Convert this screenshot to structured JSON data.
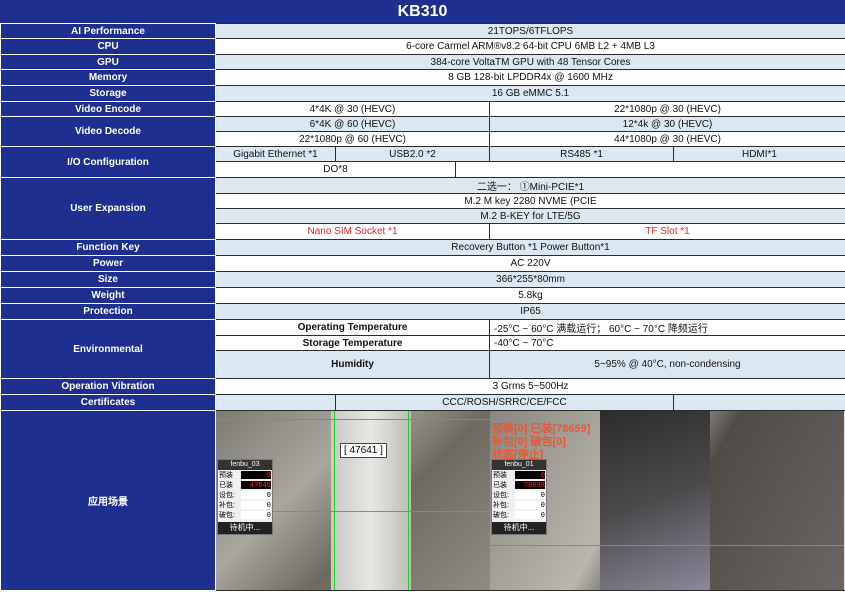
{
  "title": "KB310",
  "rows": {
    "ai_perf": {
      "label": "AI Performance",
      "value": "21TOPS/6TFLOPS"
    },
    "cpu": {
      "label": "CPU",
      "value": "6-core  Carmel ARM®v8.2 64-bit CPU 6MB L2 + 4MB L3"
    },
    "gpu": {
      "label": "GPU",
      "value": "384-core VoltaTM GPU with 48 Tensor Cores"
    },
    "memory": {
      "label": "Memory",
      "value": "8 GB 128-bit LPDDR4x @ 1600 MHz"
    },
    "storage": {
      "label": "Storage",
      "value": "16 GB eMMC 5.1"
    },
    "video_encode": {
      "label": "Video Encode",
      "left": "4*4K @ 30 (HEVC)",
      "right": "22*1080p @ 30 (HEVC)"
    },
    "video_decode": {
      "label": "Video Decode",
      "r1_left": "6*4K @ 60 (HEVC)",
      "r1_right": "12*4k @ 30 (HEVC)",
      "r2_left": "22*1080p @ 60 (HEVC)",
      "r2_right": "44*1080p @ 30 (HEVC)"
    },
    "io": {
      "label": "I/O Configuration",
      "c1": "Gigabit Ethernet *1",
      "c2": "USB2.0 *2",
      "c3": "RS485 *1",
      "c4": "HDMI*1",
      "c5": "DO*8"
    },
    "user_exp": {
      "label": "User Expansion",
      "r1": "二选一：  ①Mini-PCIE*1",
      "r2": "M.2 M key 2280 NVME   (PCIE",
      "r3": "M.2 B-KEY for LTE/5G",
      "r4_left": "Nano SIM Socket *1",
      "r4_right": "TF Slot *1"
    },
    "function_key": {
      "label": "Function Key",
      "value": "Recovery Button *1 Power Button*1"
    },
    "power": {
      "label": "Power",
      "value": "AC 220V"
    },
    "size": {
      "label": "Size",
      "value": "366*255*80mm"
    },
    "weight": {
      "label": "Weight",
      "value": "5.8kg"
    },
    "protection": {
      "label": "Protection",
      "value": "IP65"
    },
    "environmental": {
      "label": "Environmental",
      "op_label": "Operating Temperature",
      "op_value": "-25°C ~ 60°C 满载运行；  60°C ~ 70°C 降频运行",
      "st_label": "Storage Temperature",
      "st_value": "-40°C ~ 70°C",
      "hum_label": "Humidity",
      "hum_value": "5~95% @ 40°C, non-condensing"
    },
    "vibration": {
      "label": "Operation Vibration",
      "value": "3 Grms 5~500Hz"
    },
    "certificates": {
      "label": "Certificates",
      "value": "CCC/ROSH/SRRC/CE/FCC"
    },
    "scenario": {
      "label": "应用场景"
    }
  },
  "photo1": {
    "tag": "[ 47641 ]",
    "panel_title": "fenbu_03",
    "preset_label": "预装",
    "preset_value": "0",
    "loaded_label": "已装",
    "loaded_value": "47640",
    "set_label": "设包:",
    "add_label": "补包:",
    "broken_label": "破包:",
    "zero": "0",
    "wait": "待机中..."
  },
  "photo2": {
    "ocr_lines": [
      "预装[0] 已装[78659]",
      "补包[0] 破包[0]",
      "状态[停止]"
    ],
    "panel_title": "fenbu_01",
    "preset_label": "预装",
    "preset_value": "0",
    "loaded_label": "已装",
    "loaded_value": "78658",
    "set_label": "设包:",
    "add_label": "补包:",
    "broken_label": "破包:",
    "zero": "0",
    "wait": "待机中..."
  }
}
